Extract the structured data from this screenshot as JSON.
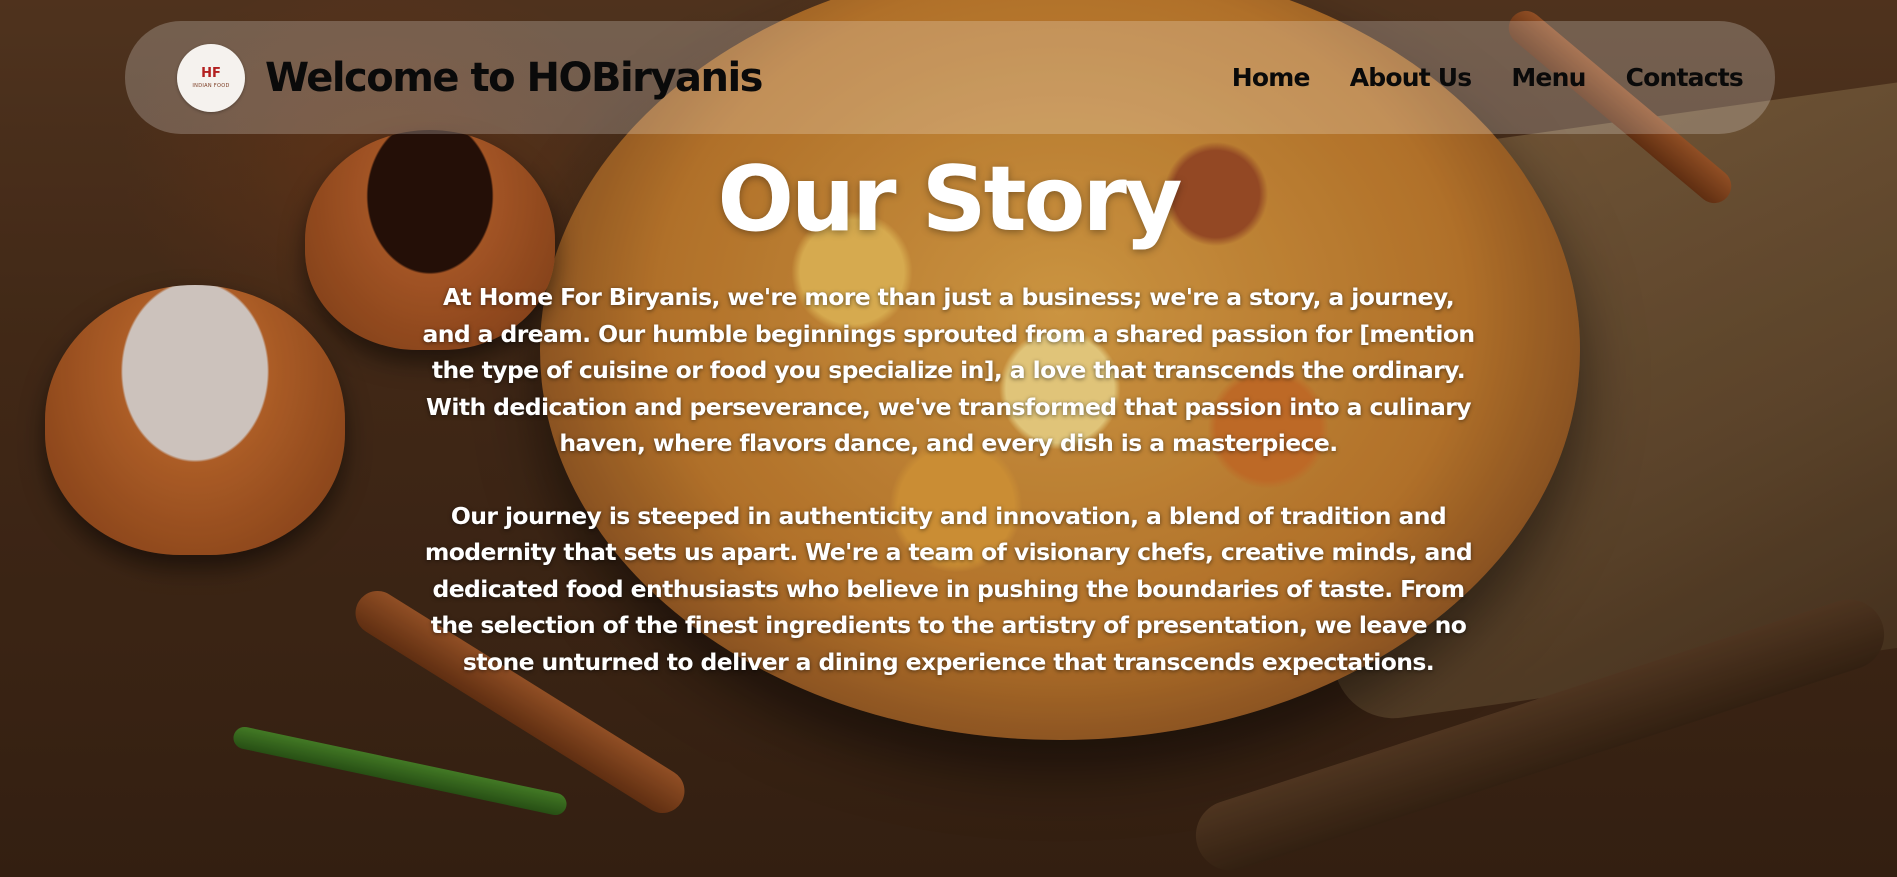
{
  "header": {
    "logo_mark": "HF",
    "logo_text": "INDIAN FOOD",
    "title": "Welcome to HOBiryanis"
  },
  "nav": {
    "items": [
      {
        "label": "Home"
      },
      {
        "label": "About Us"
      },
      {
        "label": "Menu"
      },
      {
        "label": "Contacts"
      }
    ]
  },
  "story": {
    "title": "Our Story",
    "paragraphs": [
      "At Home For Biryanis, we're more than just a business; we're a story, a journey, and a dream. Our humble beginnings sprouted from a shared passion for [mention the type of cuisine or food you specialize in], a love that transcends the ordinary. With dedication and perseverance, we've transformed that passion into a culinary haven, where flavors dance, and every dish is a masterpiece.",
      "Our journey is steeped in authenticity and innovation, a blend of tradition and modernity that sets us apart. We're a team of visionary chefs, creative minds, and dedicated food enthusiasts who believe in pushing the boundaries of taste. From the selection of the finest ingredients to the artistry of presentation, we leave no stone unturned to deliver a dining experience that transcends expectations."
    ]
  },
  "colors": {
    "text_primary": "#ffffff",
    "header_text": "#0a0a0a",
    "logo_accent": "#b32020"
  }
}
